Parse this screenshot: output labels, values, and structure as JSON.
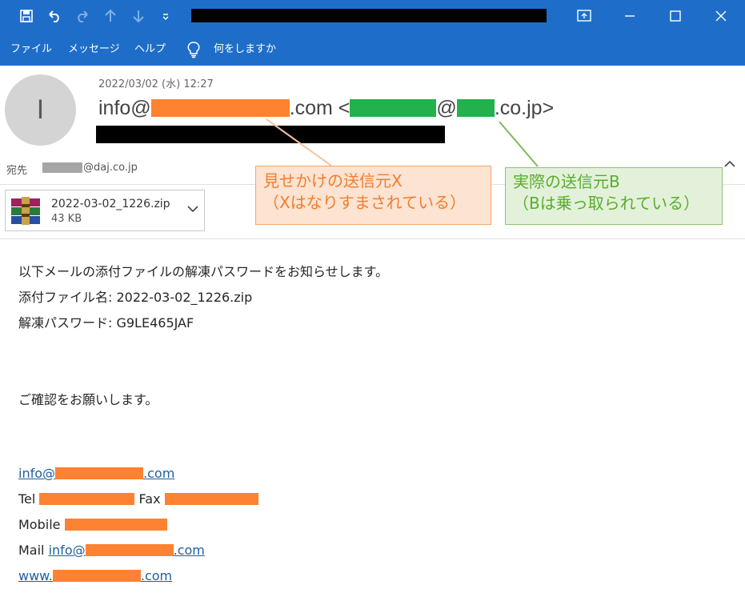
{
  "titlebar": {
    "quick_access": [
      "save-icon",
      "undo-icon",
      "redo-icon",
      "up-arrow-icon",
      "down-arrow-icon",
      "customize-icon"
    ],
    "window_buttons": [
      "restore-layout-icon",
      "minimize-icon",
      "maximize-icon",
      "close-icon"
    ]
  },
  "menu": {
    "file": "ファイル",
    "message": "メッセージ",
    "help": "ヘルプ",
    "tell_me": "何をしますか"
  },
  "header": {
    "avatar_initial": "I",
    "date": "2022/03/02 (水) 12:27",
    "from_prefix": "info@",
    "from_mid": ".com <",
    "from_at": "@",
    "from_suffix": ".co.jp>",
    "to_label": "宛先",
    "to_domain": "@daj.co.jp"
  },
  "attachment": {
    "name": "2022-03-02_1226.zip",
    "size": "43 KB"
  },
  "callouts": {
    "fake_sender_line1": "見せかけの送信元X",
    "fake_sender_line2": "（Xはなりすまされている）",
    "real_sender_line1": "実際の送信元B",
    "real_sender_line2": "（Bは乗っ取られている）"
  },
  "body": {
    "line1": "以下メールの添付ファイルの解凍パスワードをお知らせします。",
    "line2": "添付ファイル名: 2022-03-02_1226.zip",
    "line3": "解凍パスワード: G9LE465JAF",
    "line4": "ご確認をお願いします。"
  },
  "signature": {
    "email_prefix": "info@",
    "email_suffix": ".com",
    "tel_label": "Tel",
    "fax_label": "Fax",
    "mobile_label": "Mobile",
    "mail_label": "Mail",
    "mail_prefix": "info@",
    "mail_suffix": ".com",
    "web_prefix": "www.",
    "web_suffix": ".com"
  },
  "colors": {
    "titlebar": "#1e6ec9",
    "redaction_orange": "#fd8232",
    "redaction_green": "#22b14c",
    "callout_orange_text": "#f07e2e",
    "callout_green_text": "#5aad2c"
  }
}
